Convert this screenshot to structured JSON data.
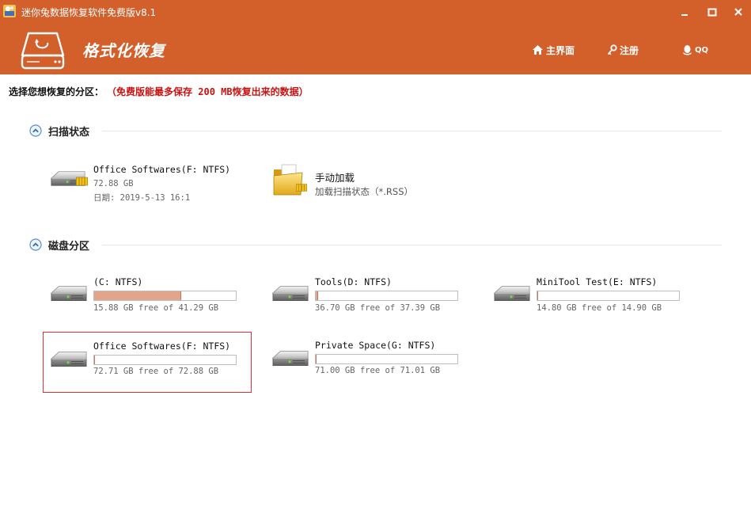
{
  "window": {
    "title": "迷你兔数据恢复软件免费版v8.1"
  },
  "header": {
    "module_title": "格式化恢复",
    "nav": {
      "home": "主界面",
      "register": "注册",
      "qq": "QQ"
    },
    "colors": {
      "accent": "#d35f2b"
    }
  },
  "instruction": {
    "label": "选择您想恢复的分区：",
    "note": "（免费版能最多保存 200 MB恢复出来的数据）"
  },
  "scan_section": {
    "label": "扫描状态",
    "last_scan": {
      "name": "Office Softwares(F: NTFS)",
      "size": "72.88 GB",
      "date": "日期: 2019-5-13 16:1"
    },
    "manual_load": {
      "title": "手动加载",
      "subtitle": "加载扫描状态（*.RSS）"
    }
  },
  "disk_section": {
    "label": "磁盘分区",
    "partitions": [
      {
        "name": "(C: NTFS)",
        "free_text": "15.88 GB free of 41.29 GB",
        "used_fraction": 0.615
      },
      {
        "name": "Tools(D: NTFS)",
        "free_text": "36.70 GB free of 37.39 GB",
        "used_fraction": 0.018
      },
      {
        "name": "MiniTool Test(E: NTFS)",
        "free_text": "14.80 GB free of 14.90 GB",
        "used_fraction": 0.007
      },
      {
        "name": "Office Softwares(F: NTFS)",
        "free_text": "72.71 GB free of 72.88 GB",
        "used_fraction": 0.002,
        "selected": true
      },
      {
        "name": "Private Space(G: NTFS)",
        "free_text": "71.00 GB free of 71.01 GB",
        "used_fraction": 0.0
      }
    ]
  },
  "icons": {
    "app": "app-logo-icon",
    "home": "home-icon",
    "register": "key-icon",
    "qq": "qq-penguin-icon",
    "drive": "hard-drive-icon",
    "folder": "folder-icon"
  }
}
